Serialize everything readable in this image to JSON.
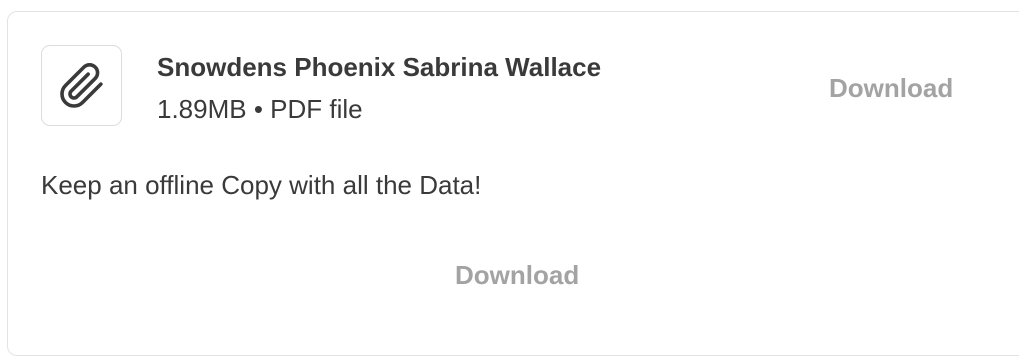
{
  "attachment": {
    "icon": "paperclip-icon",
    "file_name": "Snowdens Phoenix Sabrina Wallace",
    "file_meta": "1.89MB • PDF file",
    "download_label": "Download"
  },
  "description": "Keep an offline Copy with all the Data!",
  "footer": {
    "download_label": "Download"
  },
  "colors": {
    "text": "#3a3a3a",
    "muted_link": "#a3a3a3",
    "border": "#e3e3e3"
  }
}
